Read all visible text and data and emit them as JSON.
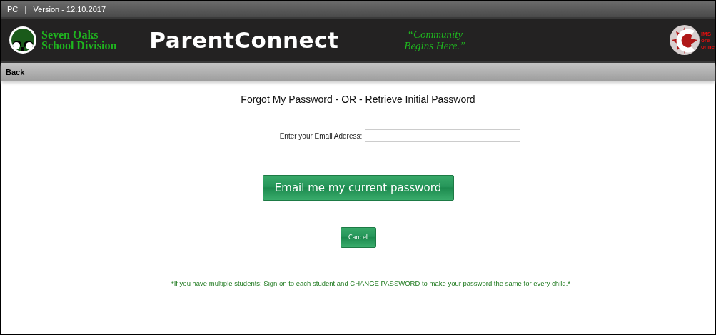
{
  "top_bar": {
    "text": "PC   |   Version - 12.10.2017"
  },
  "header": {
    "school_lines": [
      "Seven Oaks",
      "School Division"
    ],
    "app_title": "ParentConnect",
    "slogan_lines": [
      "“Community",
      "Begins Here.”"
    ],
    "logo_lines": [
      "IMS",
      "ore",
      "onne"
    ]
  },
  "nav_bar": {
    "back": "Back"
  },
  "form": {
    "title": "Forgot My Password - OR - Retrieve Initial Password",
    "email_label": "Enter your Email Address:",
    "buttons": [
      {
        "kind": "primary",
        "label": "Email me my current password"
      },
      {
        "kind": "secondary",
        "label": "Cancel"
      }
    ],
    "note": "*If you have multiple students: Sign on to each student and CHANGE PASSWORD to make your password the same for every child.*"
  }
}
